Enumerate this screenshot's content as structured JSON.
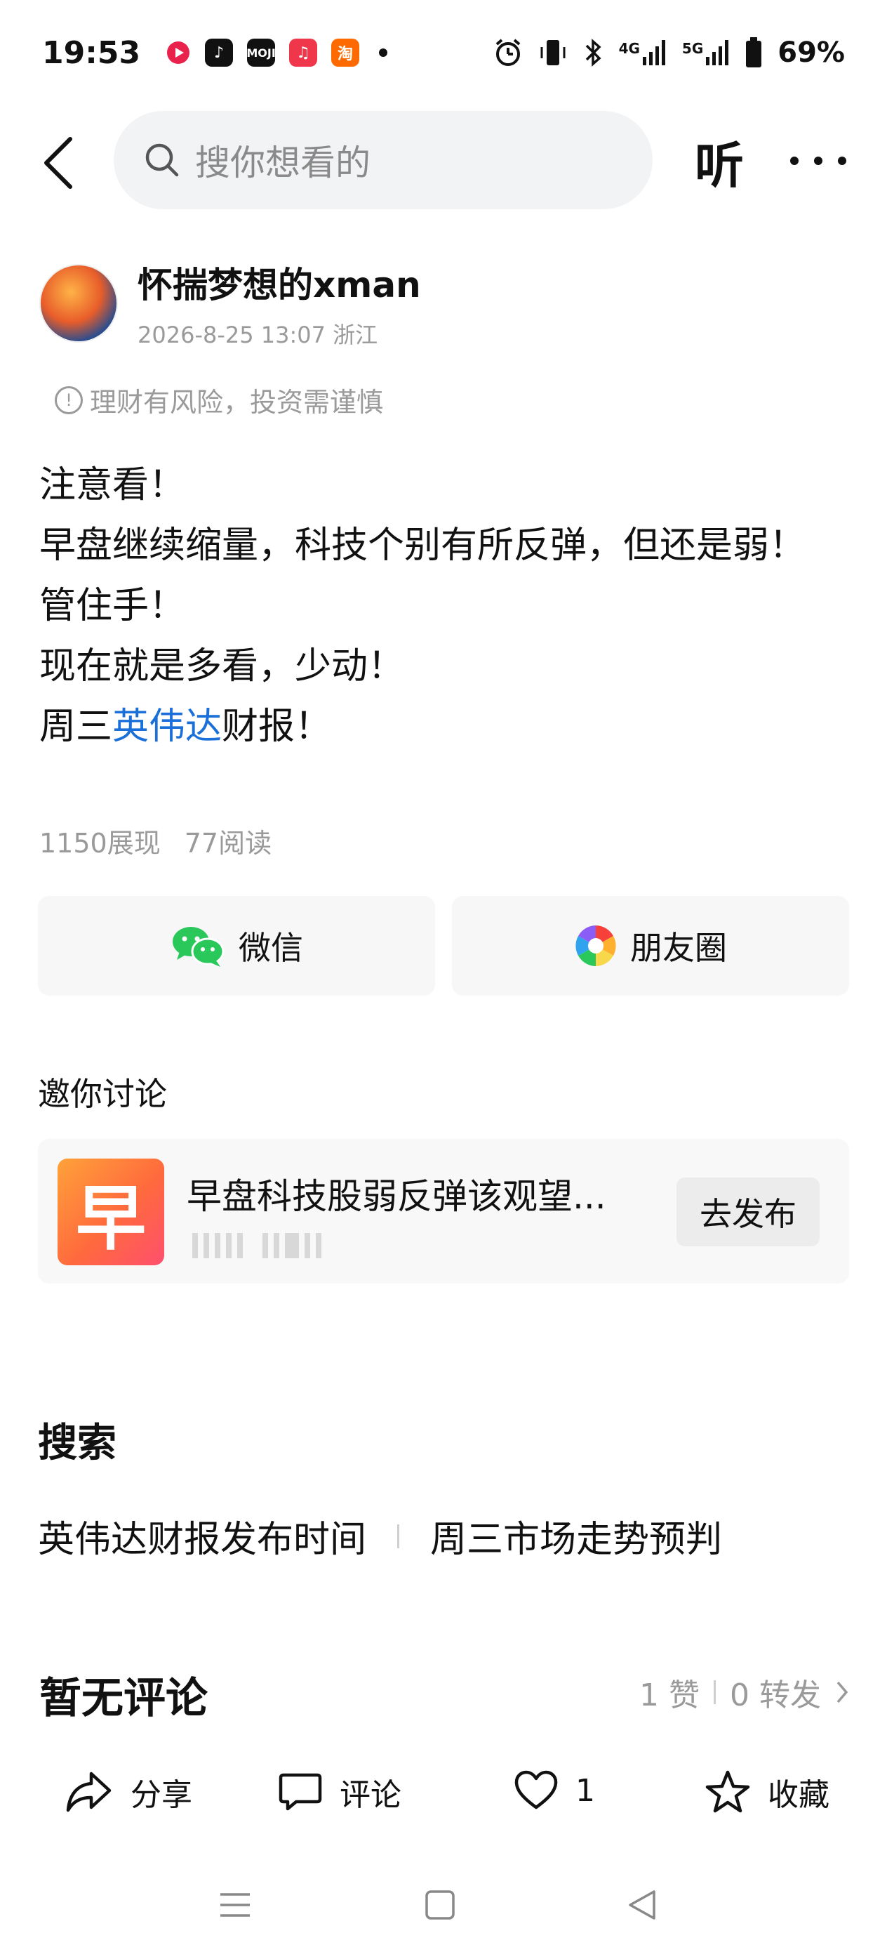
{
  "status_bar": {
    "time": "19:53",
    "network_4g": "4G",
    "network_5g": "5G",
    "battery": "69%",
    "app_icons": [
      "tiktok-icon",
      "moji-icon",
      "music-icon",
      "taobao-icon"
    ]
  },
  "header": {
    "search_placeholder": "搜你想看的",
    "listen_label": "听"
  },
  "author": {
    "name": "怀揣梦想的xman",
    "meta": "2026-8-25 13:07 浙江"
  },
  "risk_notice": "理财有风险，投资需谨慎",
  "article": {
    "line1": "注意看！",
    "line2": "早盘继续缩量，科技个别有所反弹，但还是弱！",
    "line3": "管住手！",
    "line4": "现在就是多看，少动！",
    "line5_prefix": "周三",
    "line5_link": "英伟达",
    "line5_suffix": "财报！"
  },
  "stats": {
    "impressions": "1150展现",
    "reads": "77阅读"
  },
  "share": {
    "wechat_label": "微信",
    "moments_label": "朋友圈"
  },
  "invite": {
    "title": "邀你讨论",
    "topic_thumb_char": "早",
    "topic_title": "早盘科技股弱反弹该观望...",
    "publish_label": "去发布"
  },
  "search_section": {
    "title": "搜索",
    "links": [
      "英伟达财报发布时间",
      "周三市场走势预判"
    ]
  },
  "comments": {
    "title": "暂无评论",
    "likes": "1 赞",
    "reposts": "0 转发"
  },
  "action_bar": {
    "share_label": "分享",
    "comment_label": "评论",
    "like_count": "1",
    "collect_label": "收藏"
  },
  "colors": {
    "link": "#1a6fd8",
    "secondary_text": "#9a9a9a",
    "card_bg": "#f7f7f7",
    "wechat_green": "#2ac85a"
  }
}
